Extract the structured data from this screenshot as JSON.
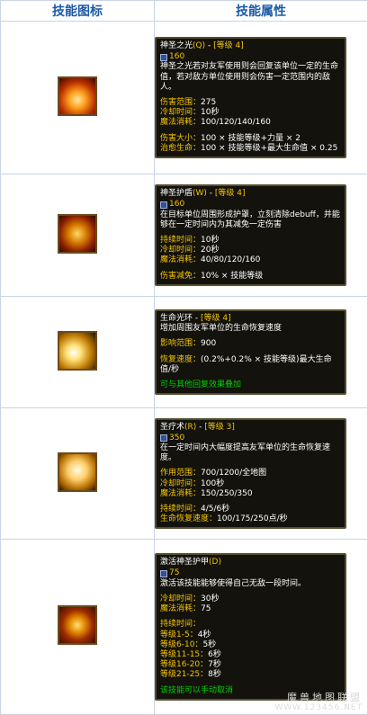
{
  "header": {
    "col_icon": "技能图标",
    "col_props": "技能属性"
  },
  "skills": [
    {
      "name": "神圣之光",
      "hotkey": "(Q)",
      "level": "[等级 4]",
      "mana": "160",
      "desc": "神圣之光若对友军使用则会回复该单位一定的生命值，若对敌方单位使用则会伤害一定范围内的敌人。",
      "stats1": [
        {
          "k": "伤害范围：",
          "v": "275"
        },
        {
          "k": "冷却时间：",
          "v": "10秒"
        },
        {
          "k": "魔法消耗：",
          "v": "100/120/140/160"
        }
      ],
      "stats2": [
        {
          "k": "伤害大小：",
          "v": "100 × 技能等级+力量 × 2"
        },
        {
          "k": "治愈生命：",
          "v": "100 × 技能等级+最大生命值 × 0.25"
        }
      ],
      "note": ""
    },
    {
      "name": "神圣护盾",
      "hotkey": "(W)",
      "level": "[等级 4]",
      "mana": "160",
      "desc": "在目标单位周围形成护罩，立刻清除debuff，并能够在一定时间内为其减免一定伤害",
      "stats1": [
        {
          "k": "持续时间：",
          "v": "10秒"
        },
        {
          "k": "冷却时间：",
          "v": "20秒"
        },
        {
          "k": "魔法消耗：",
          "v": "40/80/120/160"
        }
      ],
      "stats2": [
        {
          "k": "伤害减免：",
          "v": "10% × 技能等级"
        }
      ],
      "note": ""
    },
    {
      "name": "生命光环",
      "hotkey": "",
      "level": "[等级 4]",
      "mana": "",
      "desc": "增加周围友军单位的生命恢复速度",
      "stats1": [
        {
          "k": "影响范围：",
          "v": "900"
        }
      ],
      "stats2": [
        {
          "k": "恢复速度：",
          "v": "(0.2%+0.2% × 技能等级)最大生命值/秒"
        }
      ],
      "note": "可与其他回复效果叠加"
    },
    {
      "name": "圣疗术",
      "hotkey": "(R)",
      "level": "[等级 3]",
      "mana": "350",
      "desc": "在一定时间内大幅度提高友军单位的生命恢复速度。",
      "stats1": [
        {
          "k": "作用范围：",
          "v": "700/1200/全地图"
        },
        {
          "k": "冷却时间：",
          "v": "100秒"
        },
        {
          "k": "魔法消耗：",
          "v": "150/250/350"
        }
      ],
      "stats2": [
        {
          "k": "持续时间：",
          "v": "4/5/6秒"
        },
        {
          "k": "生命恢复速度：",
          "v": "100/175/250点/秒"
        }
      ],
      "note": ""
    },
    {
      "name": "激活神圣护甲",
      "hotkey": "(D)",
      "level": "",
      "mana": "75",
      "desc": "激活该技能能够使得自己无敌一段时间。",
      "stats1": [
        {
          "k": "冷却时间：",
          "v": "30秒"
        },
        {
          "k": "魔法消耗：",
          "v": "75"
        }
      ],
      "stats2": [
        {
          "k": "持续时间：",
          "v": ""
        },
        {
          "k": "等级1-5：",
          "v": "4秒"
        },
        {
          "k": "等级6-10：",
          "v": "5秒"
        },
        {
          "k": "等级11-15：",
          "v": "6秒"
        },
        {
          "k": "等级16-20：",
          "v": "7秒"
        },
        {
          "k": "等级21-25：",
          "v": "8秒"
        }
      ],
      "note": "该技能可以手动取消"
    }
  ],
  "icons": [
    "holy-light-icon",
    "divine-shield-icon",
    "life-aura-icon",
    "healing-hand-icon",
    "holy-armor-icon"
  ],
  "colors": {
    "header_text": "#1a5aa8",
    "tooltip_bg": "#13120c",
    "gold": "#f5c400",
    "green": "#00d000"
  },
  "watermark": {
    "line1": "魔兽地图联盟",
    "line2": "WWW.123456.NET"
  }
}
